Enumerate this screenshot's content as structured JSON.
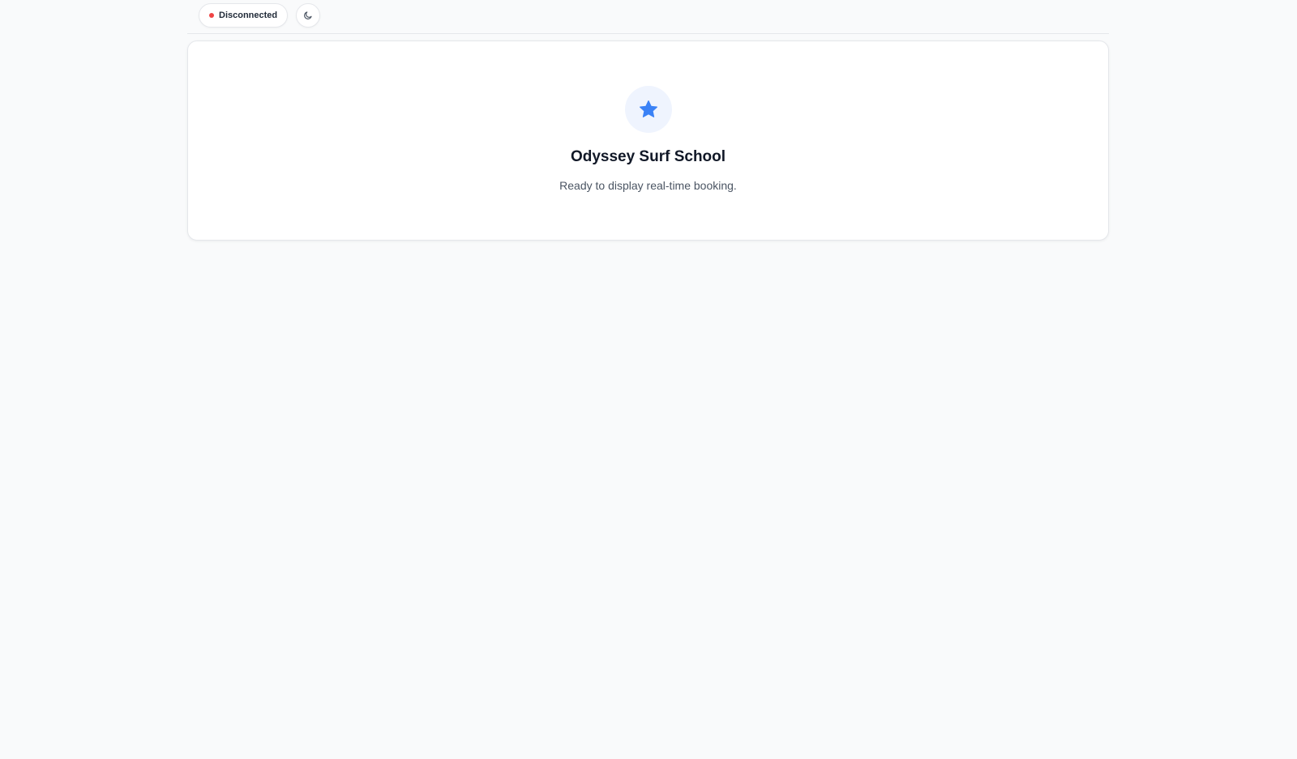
{
  "header": {
    "status": {
      "label": "Disconnected",
      "state_color": "#ef4444"
    },
    "theme_toggle": {
      "icon": "moon-icon"
    }
  },
  "card": {
    "icon": "star-icon",
    "icon_color": "#3b82f6",
    "title": "Odyssey Surf School",
    "subtitle": "Ready to display real-time booking."
  }
}
